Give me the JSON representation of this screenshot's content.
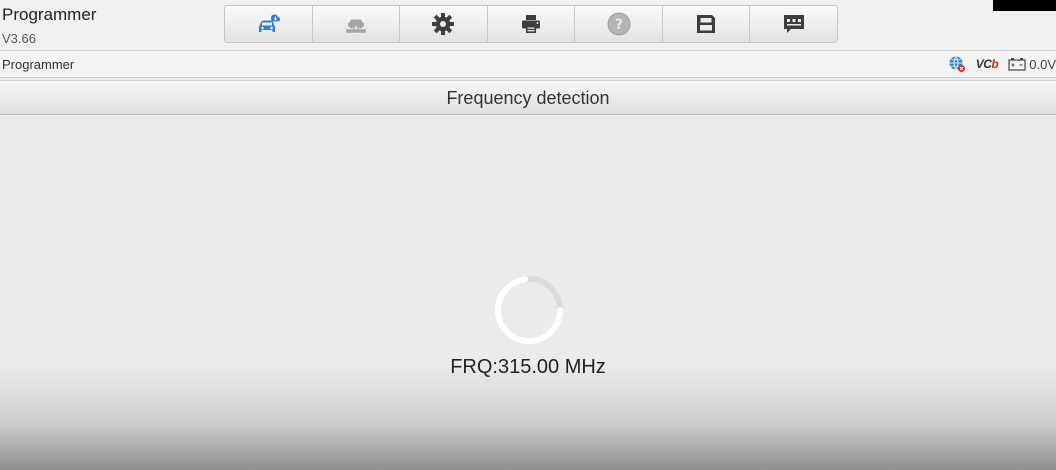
{
  "app": {
    "title": "Programmer",
    "version": "V3.66"
  },
  "toolbar": {
    "buttons": [
      {
        "name": "vehicle-cloud-icon",
        "label": ""
      },
      {
        "name": "vehicle-lift-icon",
        "label": ""
      },
      {
        "name": "gear-icon",
        "label": ""
      },
      {
        "name": "printer-icon",
        "label": ""
      },
      {
        "name": "help-icon",
        "label": ""
      },
      {
        "name": "save-icon",
        "label": ""
      },
      {
        "name": "message-icon",
        "label": ""
      }
    ]
  },
  "status": {
    "breadcrumb": "Programmer",
    "vci_text": "VC",
    "vci_suffix": "b",
    "voltage": "0.0V"
  },
  "header": {
    "title": "Frequency detection"
  },
  "main": {
    "frequency_text": "FRQ:315.00 MHz"
  },
  "colors": {
    "accent_blue": "#2f7fd0",
    "icon_dark": "#3d3d3d",
    "vci_red": "#d8262c"
  }
}
